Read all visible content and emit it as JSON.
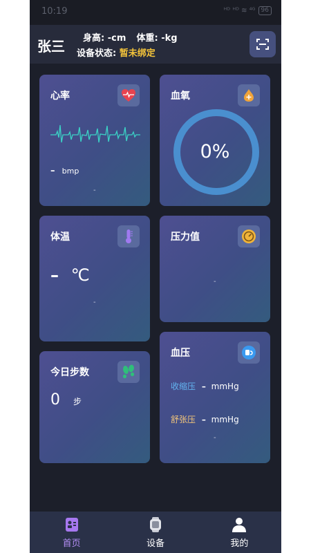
{
  "status_bar": {
    "time": "10:19",
    "icons": "ᴴᴰ ᴴᴰ ≋ ⁴ᴳ",
    "battery": "96"
  },
  "header": {
    "user_name": "张三",
    "height_label": "身高:",
    "height_value": "-cm",
    "weight_label": "体重:",
    "weight_value": "-kg",
    "device_status_label": "设备状态:",
    "device_status_value": "暂未绑定",
    "scan_icon": "scan-icon"
  },
  "cards": {
    "heart_rate": {
      "title": "心率",
      "value": "–",
      "unit": "bmp",
      "footer": "-",
      "icon": "heart-icon",
      "accent": "#3bd3c6"
    },
    "blood_oxygen": {
      "title": "血氧",
      "value": "0%",
      "icon": "drop-icon",
      "progress": 0,
      "ring_color": "#4a8fcf"
    },
    "temperature": {
      "title": "体温",
      "value": "–",
      "unit": "℃",
      "footer": "-",
      "icon": "thermometer-icon"
    },
    "stress": {
      "title": "压力值",
      "footer": "-",
      "icon": "gauge-icon"
    },
    "steps": {
      "title": "今日步数",
      "value": "0",
      "unit": "步",
      "icon": "footprints-icon"
    },
    "blood_pressure": {
      "title": "血压",
      "systolic_label": "收缩压",
      "systolic_value": "–",
      "systolic_unit": "mmHg",
      "diastolic_label": "舒张压",
      "diastolic_value": "–",
      "diastolic_unit": "mmHg",
      "footer": "-",
      "icon": "blood-pressure-icon",
      "systolic_color": "#63b3f0",
      "diastolic_color": "#f3c57a"
    }
  },
  "tabbar": {
    "tabs": [
      {
        "label": "首页",
        "icon": "home-card-icon",
        "active": true
      },
      {
        "label": "设备",
        "icon": "watch-icon",
        "active": false
      },
      {
        "label": "我的",
        "icon": "person-icon",
        "active": false
      }
    ]
  }
}
